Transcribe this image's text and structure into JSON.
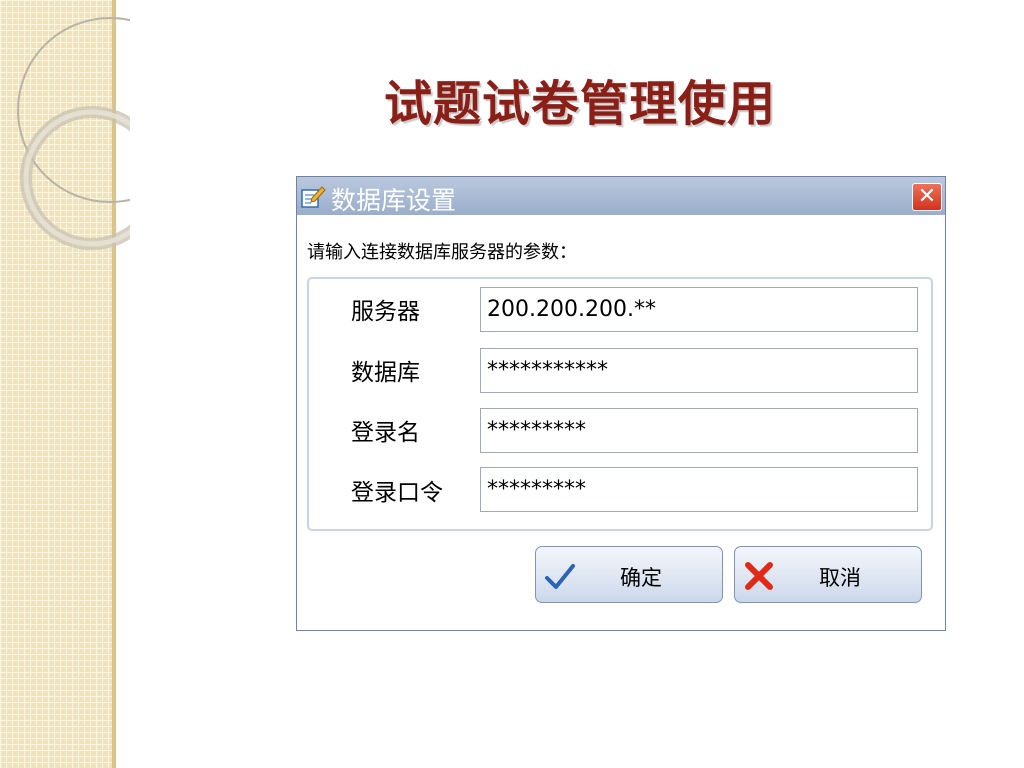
{
  "slide": {
    "title": "试题试卷管理使用"
  },
  "dialog": {
    "title": "数据库设置",
    "close_label": "✕",
    "prompt": "请输入连接数据库服务器的参数：",
    "fields": [
      {
        "label": "服务器",
        "value": "200.200.200.**"
      },
      {
        "label": "数据库",
        "value": "***********"
      },
      {
        "label": "登录名",
        "value": "*********"
      },
      {
        "label": "登录口令",
        "value": "*********"
      }
    ],
    "buttons": {
      "ok": {
        "label": "确定",
        "icon": "checkmark-icon"
      },
      "cancel": {
        "label": "取消",
        "icon": "red-x-icon"
      }
    }
  },
  "colors": {
    "title_text": "#8a1f17",
    "titlebar": "#a9bad4",
    "close_button": "#d0331e",
    "strip": "#efe2bd"
  }
}
